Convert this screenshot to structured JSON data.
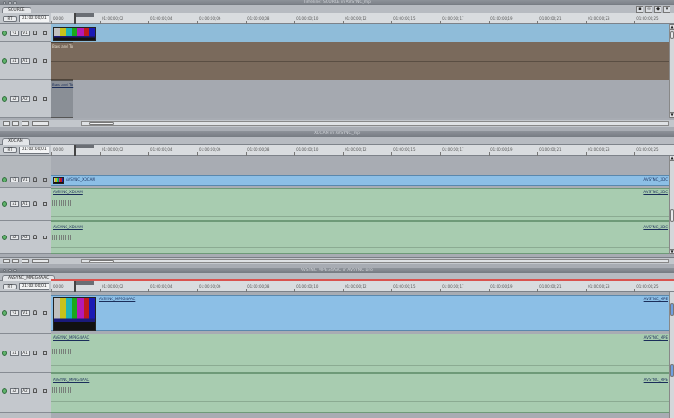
{
  "panels": [
    {
      "title": "Timeline: SOURCE in AVSYNC_mp",
      "tab": "SOURCE",
      "timecode": "01:00:00;01",
      "rt": "RT",
      "ruler": [
        "00;00",
        "01:00:00;02",
        "01:00:00;04",
        "01:00:00;06",
        "01:00:00;08",
        "01:00:00;10",
        "01:00:00;12",
        "01:00:00;15",
        "01:00:00;17",
        "01:00:00;19",
        "01:00:00;21",
        "01:00:00;23",
        "01:00:00;25"
      ],
      "tracks": {
        "v1_src": "v1",
        "v1_dst": "V1",
        "a1_src": "a1",
        "a1_dst": "A1",
        "a2_src": "a2",
        "a2_dst": "A2"
      },
      "clips": {
        "a1": "Bars and To",
        "a2": "Bars and To"
      }
    },
    {
      "title": "XDCAM in AVSYNC_mp",
      "tab": "XDCAM",
      "timecode": "01:00:00;01",
      "rt": "RT",
      "ruler": [
        "00;00",
        "01:00:00;02",
        "01:00:00;04",
        "01:00:00;06",
        "01:00:00;08",
        "01:00:00;10",
        "01:00:00;12",
        "01:00:00;15",
        "01:00:00;17",
        "01:00:00;19",
        "01:00:00;21",
        "01:00:00;23",
        "01:00:00;25"
      ],
      "tracks": {
        "v1_src": "v1",
        "v1_dst": "V1",
        "a1_src": "a1",
        "a1_dst": "A1",
        "a2_src": "a2",
        "a2_dst": "A2"
      },
      "clips": {
        "v1": "AVSYNC_XDCAM",
        "v1_end": "AVSYNC_XDC",
        "a1": "AVSYNC_XDCAM",
        "a1_end": "AVSYNC_XDC",
        "a2": "AVSYNC_XDCAM",
        "a2_end": "AVSYNC_XDC"
      }
    },
    {
      "title": "AVSYNC_MPEG4AAC in AVSYNC_proj",
      "tab": "AVSYNC_MPEG4AAC",
      "timecode": "01:00:00;01",
      "rt": "RT",
      "ruler": [
        "00;00",
        "01:00:00;02",
        "01:00:00;04",
        "01:00:00;06",
        "01:00:00;08",
        "01:00:00;10",
        "01:00:00;12",
        "01:00:00;15",
        "01:00:00;17",
        "01:00:00;19",
        "01:00:00;21",
        "01:00:00;23",
        "01:00:00;25"
      ],
      "tracks": {
        "v1_src": "v1",
        "v1_dst": "V1",
        "a1_src": "a1",
        "a1_dst": "A1",
        "a2_src": "a2",
        "a2_dst": "A2"
      },
      "clips": {
        "v1": "AVSYNC_MPEG4AAC",
        "v1_end": "AVSYNC_MPE",
        "a1": "AVSYNC_MPEG4AAC",
        "a1_end": "AVSYNC_MPE",
        "a2": "AVSYNC_MPEG4AAC",
        "a2_end": "AVSYNC_MPE"
      }
    }
  ],
  "colors": {
    "video_clip": "#8cbfe6",
    "audio_clip": "#a8ccb0",
    "source_clip": "#7a6a5c",
    "render_bar": "#d9534f"
  },
  "bars_colors": [
    "#c0c0c0",
    "#c7c21a",
    "#1fb4b4",
    "#1aa81a",
    "#b41ab4",
    "#c01a1a",
    "#1a1ab4"
  ]
}
